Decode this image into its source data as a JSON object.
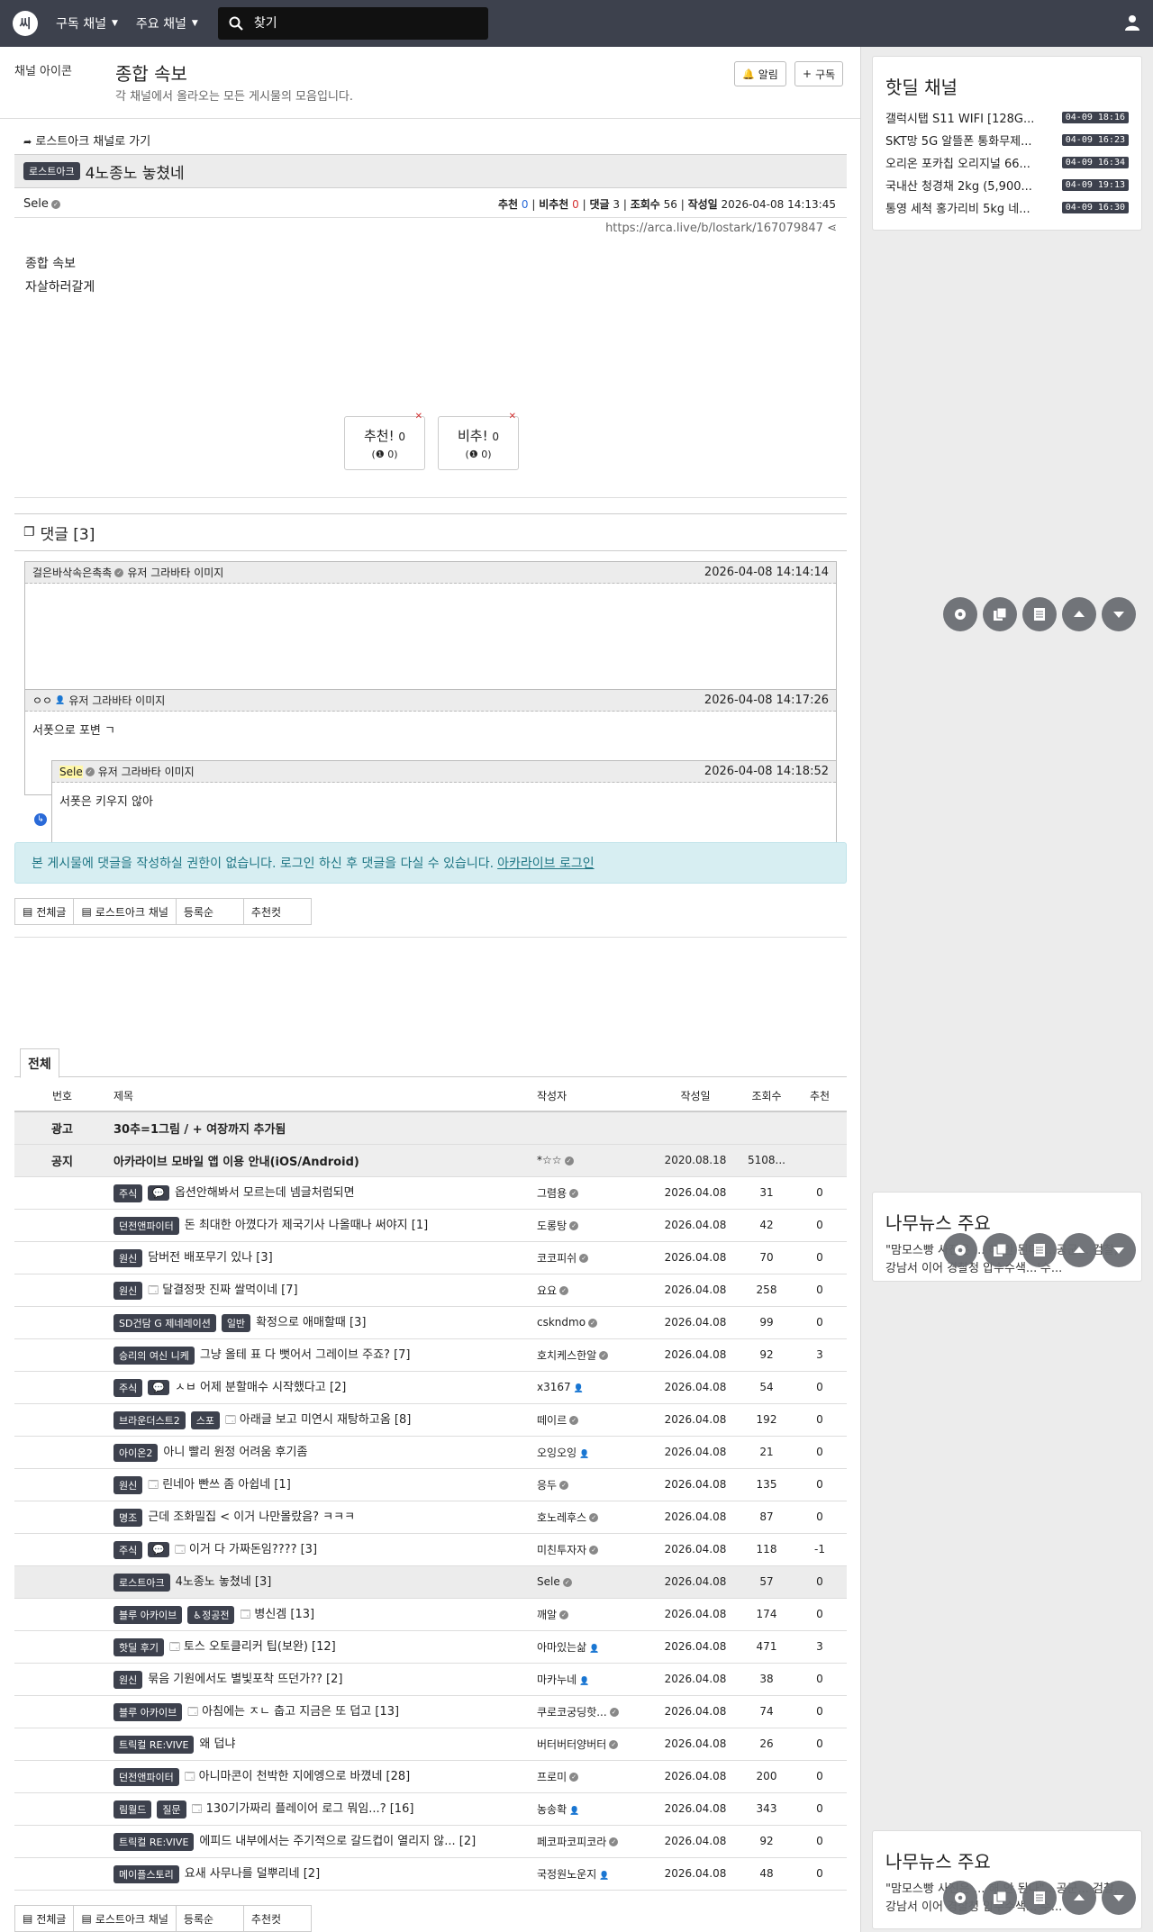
{
  "nav": {
    "logo": "씨",
    "subscribed": "구독 채널",
    "main_channels": "주요 채널",
    "search_placeholder": "찾기"
  },
  "board": {
    "channel_img_alt": "채널 아이콘",
    "title": "종합 속보",
    "description": "각 채널에서 올라오는 모든 게시물의 모음입니다.",
    "alarm": "알림",
    "subscribe": "구독"
  },
  "article": {
    "back_link": "로스트아크 채널로 가기",
    "category": "로스트아크",
    "title": "4노종노 놓쳤네",
    "author": "Sele",
    "rec_label": "추천",
    "rec": "0",
    "unrec_label": "비추천",
    "unrec": "0",
    "comments_label": "댓글",
    "comments": "3",
    "views_label": "조회수",
    "views": "56",
    "date_label": "작성일",
    "date": "2026-04-08 14:13:45",
    "url": "https://arca.live/b/lostark/167079847",
    "image_alt": "종합 속보",
    "body": "자살하러갈게",
    "vote_up": "추천!",
    "vote_up_count": "0",
    "vote_up_sub": "0",
    "vote_down": "비추!",
    "vote_down_count": "0",
    "vote_down_sub": "0"
  },
  "comments": {
    "title": "댓글 [3]",
    "avatar_alt": "유저 그라바타 이미지",
    "items": [
      {
        "author": "걸은바삭속은촉촉",
        "time": "2026-04-08 14:14:14",
        "body": ""
      },
      {
        "author": "ㅇㅇ",
        "time": "2026-04-08 14:17:26",
        "body": "서폿으로 포변 ㄱ"
      },
      {
        "author": "Sele",
        "time": "2026-04-08 14:18:52",
        "body": "서폿은 키우지 않아"
      }
    ],
    "notice": "본 게시물에 댓글을 작성하실 권한이 없습니다. 로그인 하신 후 댓글을 다실 수 있습니다.",
    "login_link": "아카라이브 로그인"
  },
  "buttons": {
    "all": "전체글",
    "channel": "로스트아크 채널",
    "order": "등록순",
    "recommend": "추천컷"
  },
  "list": {
    "tab": "전체",
    "headers": {
      "no": "번호",
      "title": "제목",
      "author": "작성자",
      "date": "작성일",
      "views": "조회수",
      "rec": "추천"
    },
    "ad": {
      "label": "광고",
      "title": "30추=1그림 / + 여장까지 추가됨"
    },
    "notice": {
      "label": "공지",
      "title": "아카라이브 모바일 앱 이용 안내(iOS/Android)",
      "author": "*☆☆",
      "date": "2020.08.18",
      "views": "5108..."
    },
    "rows": [
      {
        "badges": [
          "주식"
        ],
        "icon": "chat",
        "title": "옵션안해봐서 모르는데 넴글처럼되면",
        "author": "그렴용",
        "author_type": "v",
        "date": "2026.04.08",
        "views": "31",
        "rec": "0"
      },
      {
        "badges": [
          "던전앤파이터"
        ],
        "icon": "",
        "title": "돈 최대한 아꼈다가 제국기사 나올때나 써야지 [1]",
        "author": "도롱탕",
        "author_type": "v",
        "date": "2026.04.08",
        "views": "42",
        "rec": "0"
      },
      {
        "badges": [
          "원신"
        ],
        "icon": "",
        "title": "담버전 배포무기 있나 [3]",
        "author": "코코피쉬",
        "author_type": "v",
        "date": "2026.04.08",
        "views": "70",
        "rec": "0"
      },
      {
        "badges": [
          "원신"
        ],
        "icon": "img",
        "title": "달결정팟 진짜 쌀먹이네 [7]",
        "author": "요요",
        "author_type": "v",
        "date": "2026.04.08",
        "views": "258",
        "rec": "0"
      },
      {
        "badges": [
          "SD건담 G 제네레이션",
          "일반"
        ],
        "icon": "",
        "title": "확정으로 애매할때 [3]",
        "author": "cskndmo",
        "author_type": "v",
        "date": "2026.04.08",
        "views": "99",
        "rec": "0"
      },
      {
        "badges": [
          "승리의 여신 니케"
        ],
        "icon": "",
        "title": "그냥 올테 표 다 뻣어서 그레이브 주죠? [7]",
        "author": "호치케스한알",
        "author_type": "v",
        "date": "2026.04.08",
        "views": "92",
        "rec": "3"
      },
      {
        "badges": [
          "주식"
        ],
        "icon": "chat",
        "title": "ㅅㅂ 어제 분할매수 시작했다고 [2]",
        "author": "x3167",
        "author_type": "u",
        "date": "2026.04.08",
        "views": "54",
        "rec": "0"
      },
      {
        "badges": [
          "브라운더스트2",
          "스포"
        ],
        "icon": "img",
        "title": "아래글 보고 미연시 재탕하고옴 [8]",
        "author": "떼이르",
        "author_type": "v",
        "date": "2026.04.08",
        "views": "192",
        "rec": "0"
      },
      {
        "badges": [
          "아이온2"
        ],
        "icon": "",
        "title": "아니 빨리 원정 어려움 후기좀",
        "author": "오잉오잉",
        "author_type": "u",
        "date": "2026.04.08",
        "views": "21",
        "rec": "0"
      },
      {
        "badges": [
          "원신"
        ],
        "icon": "img",
        "title": "린네아 빤쓰 좀 아쉽네 [1]",
        "author": "응두",
        "author_type": "v",
        "date": "2026.04.08",
        "views": "135",
        "rec": "0"
      },
      {
        "badges": [
          "명조"
        ],
        "icon": "",
        "title": "근데 조화밀집 < 이거 나만몰랐음? ㅋㅋㅋ",
        "author": "호노레후스",
        "author_type": "v",
        "date": "2026.04.08",
        "views": "87",
        "rec": "0"
      },
      {
        "badges": [
          "주식"
        ],
        "icon": "chat-img",
        "title": "이거 다 가짜돈임???? [3]",
        "author": "미친투자자",
        "author_type": "v",
        "date": "2026.04.08",
        "views": "118",
        "rec": "-1"
      },
      {
        "badges": [
          "로스트아크"
        ],
        "icon": "",
        "title": "4노종노 놓쳤네 [3]",
        "author": "Sele",
        "author_type": "v",
        "date": "2026.04.08",
        "views": "57",
        "rec": "0",
        "current": true
      },
      {
        "badges": [
          "블루 아카이브",
          "♿정공전"
        ],
        "icon": "img",
        "title": "병신겜 [13]",
        "author": "깨알",
        "author_type": "v",
        "date": "2026.04.08",
        "views": "174",
        "rec": "0"
      },
      {
        "badges": [
          "핫딜 후기"
        ],
        "icon": "img",
        "title": "토스 오토클리커 팁(보완) [12]",
        "author": "아마있는삶",
        "author_type": "u",
        "date": "2026.04.08",
        "views": "471",
        "rec": "3"
      },
      {
        "badges": [
          "원신"
        ],
        "icon": "",
        "title": "묶음 기원에서도 별빛포착 뜨던가?? [2]",
        "author": "마카누네",
        "author_type": "u",
        "date": "2026.04.08",
        "views": "38",
        "rec": "0"
      },
      {
        "badges": [
          "블루 아카이브"
        ],
        "icon": "img",
        "title": "아침에는 ㅈㄴ 춥고 지금은 또 덥고 [13]",
        "author": "쿠로코궁딩핫...",
        "author_type": "v",
        "date": "2026.04.08",
        "views": "74",
        "rec": "0"
      },
      {
        "badges": [
          "트릭컬 RE:VIVE"
        ],
        "icon": "",
        "title": "왜 덥냐",
        "author": "버터버터양버터",
        "author_type": "v",
        "date": "2026.04.08",
        "views": "26",
        "rec": "0"
      },
      {
        "badges": [
          "던전앤파이터"
        ],
        "icon": "img",
        "title": "아니마콘이 천박한 지에엥으로 바꼈네 [28]",
        "author": "프로미",
        "author_type": "v",
        "date": "2026.04.08",
        "views": "200",
        "rec": "0"
      },
      {
        "badges": [
          "림월드",
          "질문"
        ],
        "icon": "img",
        "title": "130기가짜리 플레이어 로그 뭐임...? [16]",
        "author": "농송확",
        "author_type": "u",
        "date": "2026.04.08",
        "views": "343",
        "rec": "0"
      },
      {
        "badges": [
          "트릭컬 RE:VIVE"
        ],
        "icon": "",
        "title": "에피드 내부에서는 주기적으로 갈드컵이 열리지 않... [2]",
        "author": "페코파코피코라",
        "author_type": "v",
        "date": "2026.04.08",
        "views": "92",
        "rec": "0"
      },
      {
        "badges": [
          "메이플스토리"
        ],
        "icon": "",
        "title": "요새 사무나를 덜뿌리네 [2]",
        "author": "국정원노운지",
        "author_type": "u",
        "date": "2026.04.08",
        "views": "48",
        "rec": "0"
      }
    ]
  },
  "side": {
    "hotdeal_title": "핫딜 채널",
    "hotdeal": [
      {
        "title": "갤럭시탭 S11 WIFI [128G...",
        "date": "04-09 18:16"
      },
      {
        "title": "SKT망 5G 알뜰폰 통화무제...",
        "date": "04-09 16:23"
      },
      {
        "title": "오리온 포카칩 오리지널 66...",
        "date": "04-09 16:34"
      },
      {
        "title": "국내산 청경채 2kg (5,900...",
        "date": "04-09 19:13"
      },
      {
        "title": "통영 세척 홍가리비 5kg 네...",
        "date": "04-09 16:30"
      }
    ],
    "news_title": "나무뉴스 주요",
    "news_text": "\"맘모스빵 사진은 ... 해 안 된다\"…공군... 검찰, 강남서 이어 경찰청 압수수색...'수...",
    "news_title2": "나무뉴스 주요",
    "news_text2": "\"맘모스빵 사진은 ... 해 안 된다\"…공군... 검찰, 강남서 이어 경찰청 압수수색...'수..."
  },
  "colors": {
    "nav_bg": "#3d414d",
    "badge_bg": "#3d414d",
    "notice_bg": "#d7eef2",
    "notice_text": "#207785",
    "rec_blue": "#2a6ad8",
    "unrec_red": "#d43131"
  }
}
